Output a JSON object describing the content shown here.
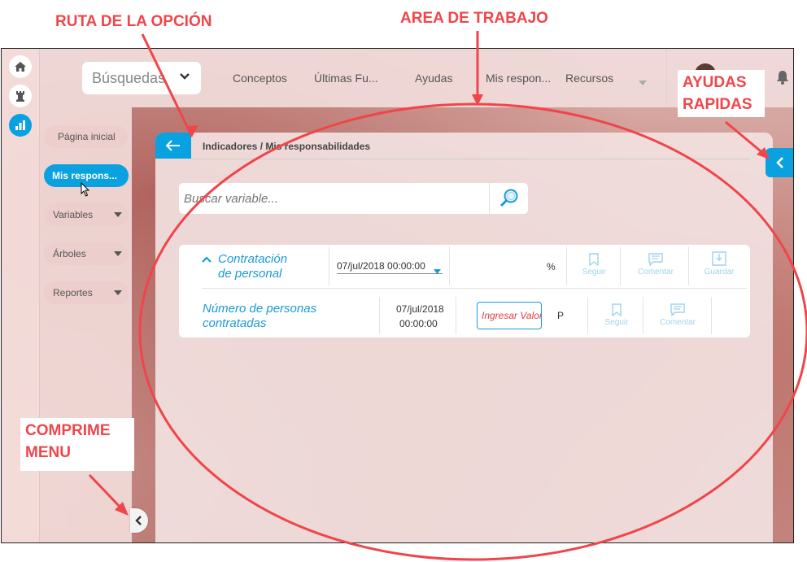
{
  "annotations": {
    "ruta": "RUTA DE LA OPCIÓN",
    "area": "AREA DE TRABAJO",
    "ayudas_line1": "AYUDAS",
    "ayudas_line2": "RAPIDAS",
    "comprime_line1": "COMPRIME",
    "comprime_line2": "MENU"
  },
  "topbar": {
    "search_label": "Búsquedas",
    "nav": [
      "Conceptos",
      "Últimas Fu...",
      "Ayudas",
      "Mis respon...",
      "Recursos"
    ]
  },
  "left_menu": {
    "items": [
      {
        "label": "Página inicial"
      },
      {
        "label": "Mis respons..."
      },
      {
        "label": "Variables"
      },
      {
        "label": "Árboles"
      },
      {
        "label": "Reportes"
      }
    ]
  },
  "work": {
    "breadcrumb": "Indicadores / Mis responsabilidades",
    "search_placeholder": "Buscar variable...",
    "indicator": {
      "line1": "Contratación",
      "line2": "de personal",
      "date": "07/jul/2018 00:00:00",
      "unit": "%",
      "actions": [
        "Seguir",
        "Comentar",
        "Guardar"
      ]
    },
    "variable": {
      "line1": "Número de personas",
      "line2": "contratadas",
      "date_line1": "07/jul/2018",
      "date_line2": "00:00:00",
      "input_value": "Ingresar Valor",
      "unit": "P",
      "actions": [
        "Seguir",
        "Comentar"
      ]
    }
  },
  "colors": {
    "accent": "#0aa1e0",
    "annotation": "#f0454a",
    "link": "#1a9ad6"
  }
}
